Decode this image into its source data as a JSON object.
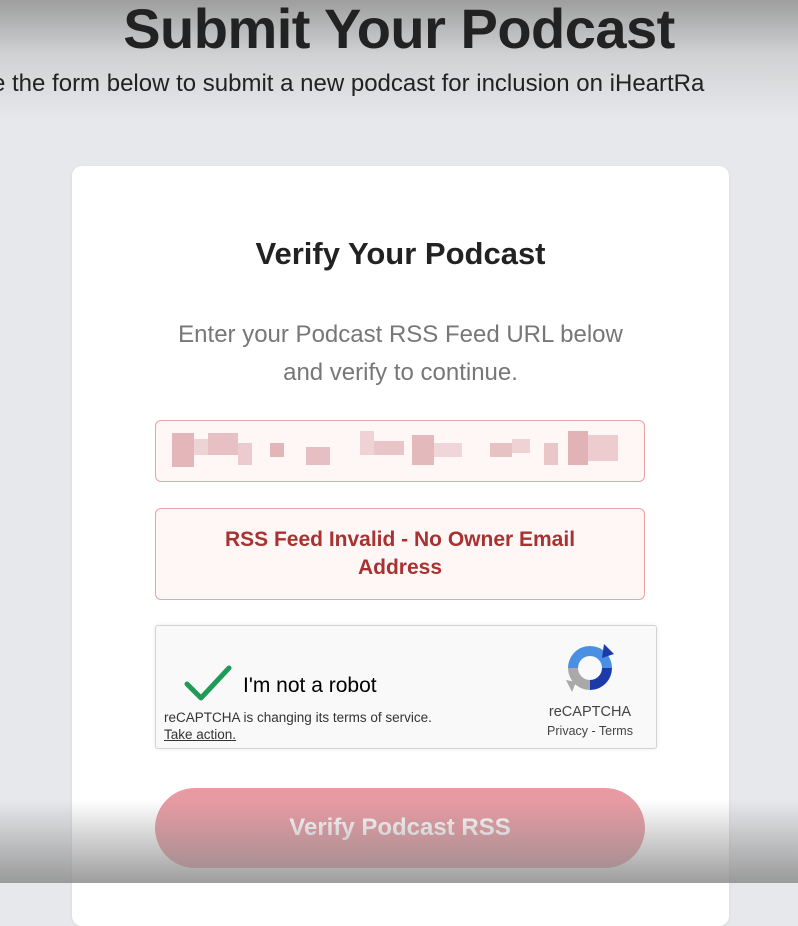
{
  "header": {
    "title": "Submit Your Podcast",
    "subtitle": "e the form below to submit a new podcast for inclusion on iHeartRa"
  },
  "card": {
    "title": "Verify Your Podcast",
    "description": "Enter your Podcast RSS Feed URL below and verify to continue.",
    "rss_input": {
      "value": "",
      "state": "error"
    },
    "error_message": "RSS Feed Invalid - No Owner Email Address",
    "recaptcha": {
      "checkbox_label": "I'm not a robot",
      "checked": true,
      "notice": "reCAPTCHA is changing its terms of service.",
      "notice_link": "Take action.",
      "brand": "reCAPTCHA",
      "privacy_link": "Privacy",
      "separator": " - ",
      "terms_link": "Terms"
    },
    "verify_button": "Verify Podcast RSS"
  },
  "colors": {
    "error_text": "#a83232",
    "error_border": "#eaa3a6",
    "button_bg": "#e89aa2",
    "check_green": "#1f9a57",
    "background": "#e6e8eb"
  }
}
